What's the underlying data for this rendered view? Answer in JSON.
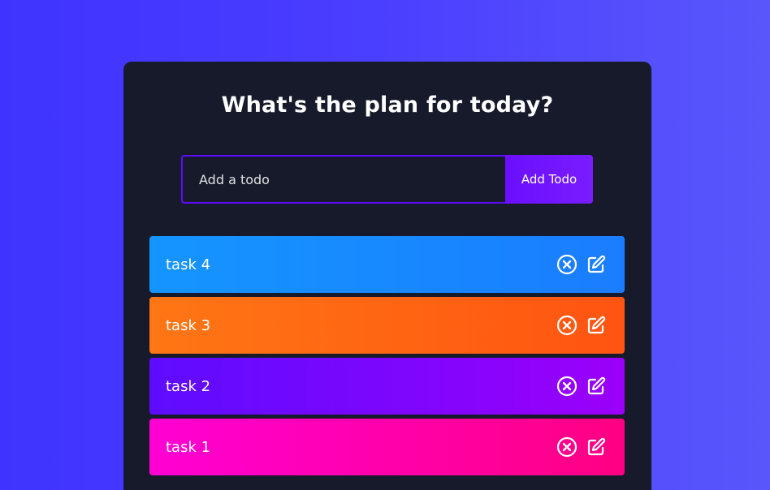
{
  "header": {
    "title": "What's the plan for today?"
  },
  "form": {
    "placeholder": "Add a todo",
    "value": "",
    "button_label": "Add Todo"
  },
  "todos": [
    {
      "text": "task 4",
      "color": "#1595ff"
    },
    {
      "text": "task 3",
      "color": "#ff7614"
    },
    {
      "text": "task 2",
      "color": "#5d0cff"
    },
    {
      "text": "task 1",
      "color": "#ff00d4"
    }
  ],
  "icons": {
    "delete": "close-circle-icon",
    "edit": "edit-icon"
  },
  "colors": {
    "background": "#4338ff",
    "panel": "#161a2b",
    "accent": "#5d0cff",
    "text": "#ffffff"
  }
}
